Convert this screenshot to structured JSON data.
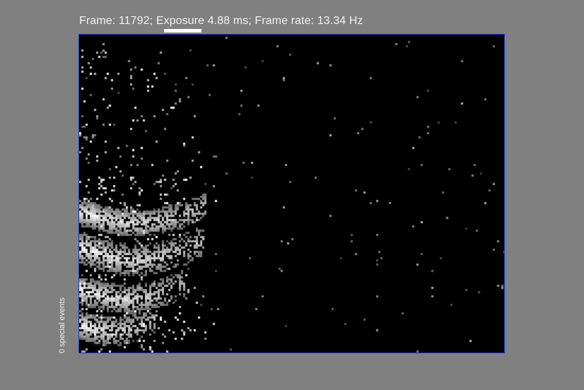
{
  "status": {
    "text": "Frame: 11792; Exposure 4.88 ms; Frame rate: 13.34 Hz"
  },
  "viewport": {
    "background": "#000000",
    "border_color": "#2233cc",
    "content": "event-camera frame, sparse white/gray pixel events concentrated at left"
  },
  "sidebar": {
    "special_events": "0 special events"
  },
  "colors": {
    "window_bg": "#808080",
    "text": "#f2f2f2"
  }
}
